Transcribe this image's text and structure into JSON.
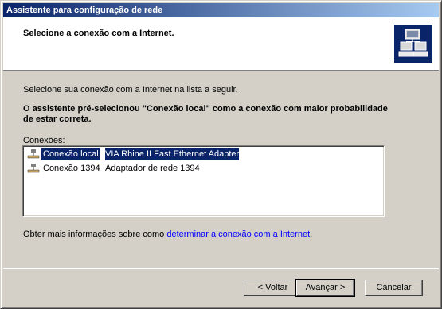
{
  "window": {
    "title": "Assistente para configuração de rede"
  },
  "header": {
    "title": "Selecione a conexão com a Internet.",
    "icon": "network-computers-icon"
  },
  "content": {
    "intro": "Selecione sua conexão com a Internet na lista a seguir.",
    "note": "O assistente pré-selecionou \"Conexão local\" como a conexão com maior probabilidade de estar correta.",
    "list_label": "Conexões:",
    "connections": [
      {
        "name": "Conexão local",
        "adapter": "VIA Rhine II Fast Ethernet Adapter",
        "selected": true
      },
      {
        "name": "Conexão 1394",
        "adapter": "Adaptador de rede 1394",
        "selected": false
      }
    ],
    "more_prefix": "Obter mais informações sobre como ",
    "more_link": "determinar a conexão com a Internet",
    "more_suffix": "."
  },
  "buttons": {
    "back": "< Voltar",
    "next": "Avançar >",
    "cancel": "Cancelar"
  },
  "colors": {
    "title_start": "#0a246a",
    "title_end": "#a6caf0",
    "selection": "#0a246a",
    "link": "#0000ff"
  }
}
